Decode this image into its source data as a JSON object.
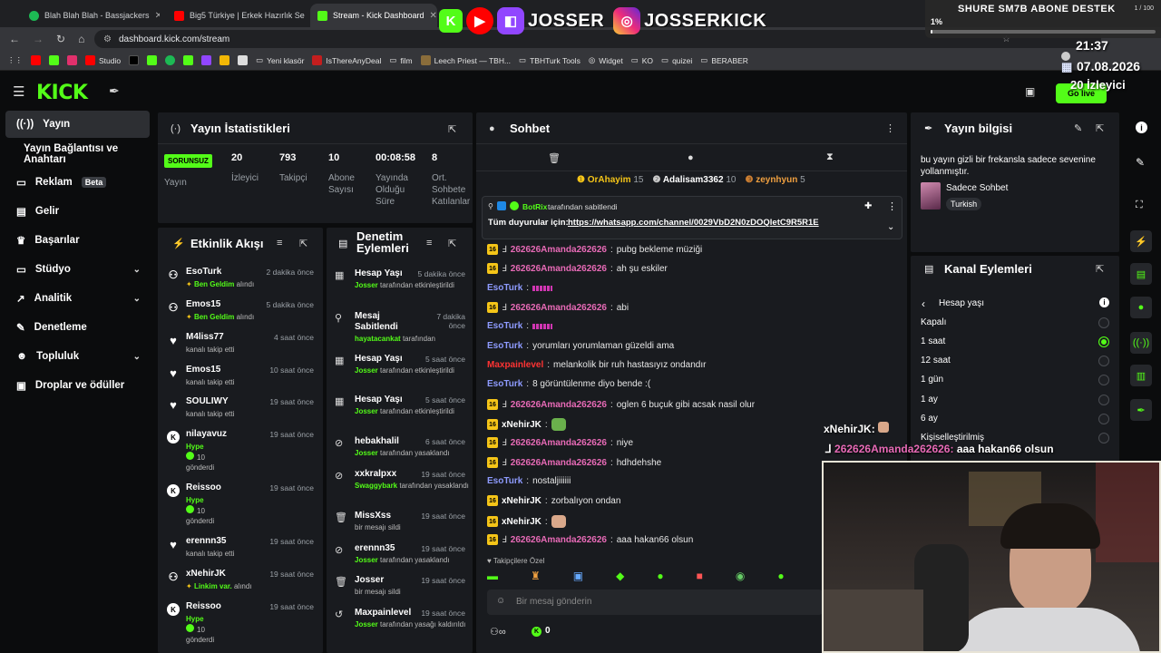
{
  "browser": {
    "tabs": [
      {
        "title": "Blah Blah Blah - Bassjackers",
        "color": "#1db954"
      },
      {
        "title": "Big5 Türkiye | Erkek Hazırlık Se",
        "color": "#ff0000"
      },
      {
        "title": "Stream - Kick Dashboard",
        "color": "#53fc18"
      }
    ],
    "url": "dashboard.kick.com/stream",
    "bookmarks": [
      "Studio",
      "Yeni klasör",
      "IsThereAnyDeal",
      "film",
      "Leech Priest — TBH...",
      "TBHTurk Tools",
      "Widget",
      "KO",
      "quizei",
      "BERABER"
    ]
  },
  "overlay": {
    "brand_names": [
      "JOSSER",
      "JOSSERKICK"
    ],
    "goal_title": "SHURE SM7B ABONE DESTEK",
    "goal_count": "1 / 100",
    "goal_percent": "1%",
    "goal_fraction": 0.01,
    "time": "21:37",
    "date": "07.08.2026",
    "viewers": "20 İzleyici",
    "go_live": "Go live"
  },
  "sidebar": {
    "items": [
      {
        "label": "Yayın"
      },
      {
        "label": "Yayın Bağlantısı ve Anahtarı"
      },
      {
        "label": "Reklam",
        "badge": "Beta"
      },
      {
        "label": "Gelir"
      },
      {
        "label": "Başarılar"
      },
      {
        "label": "Stüdyo"
      },
      {
        "label": "Analitik"
      },
      {
        "label": "Denetleme"
      },
      {
        "label": "Topluluk"
      },
      {
        "label": "Droplar ve ödüller"
      }
    ]
  },
  "stats": {
    "title": "Yayın İstatistikleri",
    "status": "SORUNSUZ",
    "status_label": "Yayın",
    "items": [
      {
        "value": "20",
        "label": "İzleyici"
      },
      {
        "value": "793",
        "label": "Takipçi"
      },
      {
        "value": "10",
        "label": "Abone Sayısı"
      },
      {
        "value": "00:08:58",
        "label": "Yayında Olduğu Süre"
      },
      {
        "value": "8",
        "label": "Ort. Sohbete Katılanlar"
      }
    ]
  },
  "feed": {
    "title": "Etkinlik Akışı",
    "rows": [
      {
        "name": "EsoTurk",
        "time": "2 dakika önce",
        "reward": "Ben Geldim",
        "tail": "alındı"
      },
      {
        "name": "Emos15",
        "time": "5 dakika önce",
        "reward": "Ben Geldim",
        "tail": "alındı"
      },
      {
        "name": "M4liss77",
        "time": "4 saat önce",
        "sub": "kanalı takip etti"
      },
      {
        "name": "Emos15",
        "time": "10 saat önce",
        "sub": "kanalı takip etti"
      },
      {
        "name": "SOULIWY",
        "time": "19 saat önce",
        "sub": "kanalı takip etti"
      },
      {
        "name": "nilayavuz",
        "time": "19 saat önce",
        "reward": "Hype",
        "amount": "10",
        "tail": "gönderdi"
      },
      {
        "name": "Reissoo",
        "time": "19 saat önce",
        "reward": "Hype",
        "amount": "10",
        "tail": "gönderdi"
      },
      {
        "name": "erennn35",
        "time": "19 saat önce",
        "sub": "kanalı takip etti"
      },
      {
        "name": "xNehirJK",
        "time": "19 saat önce",
        "reward": "Linkim var.",
        "tail": "alındı"
      },
      {
        "name": "Reissoo",
        "time": "19 saat önce",
        "reward": "Hype",
        "amount": "10",
        "tail": "gönderdi"
      }
    ]
  },
  "mod": {
    "title": "Denetim Eylemleri",
    "rows": [
      {
        "name": "Hesap Yaşı",
        "time": "5 dakika önce",
        "actor": "Josser",
        "sub": "tarafından etkinleştirildi"
      },
      {
        "name": "Mesaj Sabitlendi",
        "time": "7 dakika önce",
        "actor": "hayatacankat",
        "sub": "tarafından"
      },
      {
        "name": "Hesap Yaşı",
        "time": "5 saat önce",
        "actor": "Josser",
        "sub": "tarafından etkinleştirildi"
      },
      {
        "name": "Hesap Yaşı",
        "time": "5 saat önce",
        "actor": "Josser",
        "sub": "tarafından etkinleştirildi"
      },
      {
        "name": "hebakhalil",
        "time": "6 saat önce",
        "actor": "Josser",
        "sub": "tarafından yasaklandı"
      },
      {
        "name": "xxkralpxx",
        "time": "19 saat önce",
        "actor": "Swaggybark",
        "sub": "tarafından yasaklandı"
      },
      {
        "name": "MissXss",
        "time": "19 saat önce",
        "actor": "",
        "sub": "bir mesajı sildi"
      },
      {
        "name": "erennn35",
        "time": "19 saat önce",
        "actor": "Josser",
        "sub": "tarafından yasaklandı"
      },
      {
        "name": "Josser",
        "time": "19 saat önce",
        "actor": "",
        "sub": "bir mesajı sildi"
      },
      {
        "name": "Maxpainlevel",
        "time": "19 saat önce",
        "actor": "Josser",
        "sub": "tarafından yasağı kaldırıldı"
      }
    ]
  },
  "chat": {
    "title": "Sohbet",
    "top": [
      {
        "name": "OrAhayim",
        "count": "15"
      },
      {
        "name": "Adalisam3362",
        "count": "10"
      },
      {
        "name": "zeynhyun",
        "count": "5"
      }
    ],
    "pinned_by": "BotRix",
    "pinned_note": "tarafından sabitlendi",
    "pinned_prefix": "Tüm duyurular için:",
    "pinned_link": "https://whatsapp.com/channel/0029VbD2N0zDOQletC9R5R1E",
    "messages": [
      {
        "user": "262626Amanda262626",
        "text": "pubg bekleme müziği",
        "style": "pink",
        "badge": true
      },
      {
        "user": "262626Amanda262626",
        "text": "ah şu eskiler",
        "style": "pink",
        "badge": true
      },
      {
        "user": "EsoTurk",
        "text": "",
        "style": "blue",
        "emote": true
      },
      {
        "user": "262626Amanda262626",
        "text": "abi",
        "style": "pink",
        "badge": true
      },
      {
        "user": "EsoTurk",
        "text": "",
        "style": "blue",
        "emote": true
      },
      {
        "user": "EsoTurk",
        "text": "yorumları yorumlaman güzeldi ama",
        "style": "blue"
      },
      {
        "user": "Maxpainlevel",
        "text": "melankolik bir ruh hastasıyız ondandır",
        "style": "red"
      },
      {
        "user": "EsoTurk",
        "text": "8 görüntülenme diyo bende :(",
        "style": "blue"
      },
      {
        "user": "262626Amanda262626",
        "text": "oglen 6 buçuk gibi acsak nasil olur",
        "style": "pink",
        "badge": true
      },
      {
        "user": "xNehirJK",
        "text": "",
        "style": "white",
        "badge": true
      },
      {
        "user": "262626Amanda262626",
        "text": "niye",
        "style": "pink",
        "badge": true
      },
      {
        "user": "262626Amanda262626",
        "text": "hdhdehshe",
        "style": "pink",
        "badge": true
      },
      {
        "user": "EsoTurk",
        "text": "nostaljiiiiii",
        "style": "blue"
      },
      {
        "user": "xNehirJK",
        "text": "zorbalıyon ondan",
        "style": "white",
        "badge": true
      },
      {
        "user": "xNehirJK",
        "text": "",
        "style": "white",
        "badge": true
      },
      {
        "user": "262626Amanda262626",
        "text": "aaa hakan66 olsun",
        "style": "pink",
        "badge": true
      }
    ],
    "followers_only": "Takipçilere Özel",
    "input_placeholder": "Bir mesaj gönderin",
    "points": "0",
    "overlay_user": "xNehirJK:",
    "overlay_user2": "262626Amanda262626:",
    "overlay_msg2": "aaa hakan66 olsun"
  },
  "info": {
    "title": "Yayın bilgisi",
    "description": "bu yayın gizli bir frekansla sadece sevenine yollanmıştır.",
    "category": "Sadece Sohbet",
    "language": "Turkish"
  },
  "channel": {
    "title": "Kanal Eylemleri",
    "submenu": "Hesap yaşı",
    "options": [
      "Kapalı",
      "1 saat",
      "12 saat",
      "1 gün",
      "1 ay",
      "6 ay",
      "Kişiselleştirilmiş"
    ],
    "selected": "1 saat"
  },
  "colors": {
    "accent": "#53fc18",
    "panel": "#191b1f",
    "bg": "#0b0c0d"
  }
}
